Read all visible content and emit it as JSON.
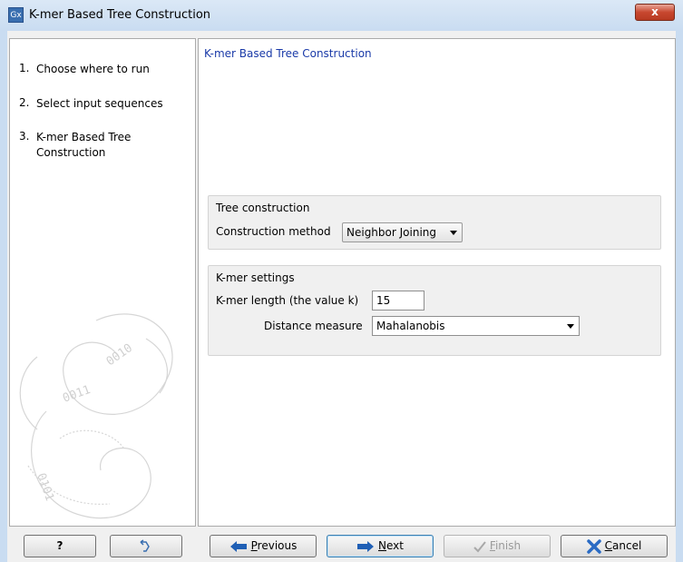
{
  "window": {
    "title": "K-mer Based Tree Construction",
    "app_icon": "Gx",
    "close_glyph": "x"
  },
  "steps": [
    {
      "num": "1.",
      "label": "Choose where to run"
    },
    {
      "num": "2.",
      "label": "Select input sequences"
    },
    {
      "num": "3.",
      "label": "K-mer Based Tree Construction"
    }
  ],
  "content": {
    "title": "K-mer Based Tree Construction",
    "tree_group": {
      "title": "Tree construction",
      "method_label": "Construction method",
      "method_value": "Neighbor Joining"
    },
    "kmer_group": {
      "title": "K-mer settings",
      "length_label": "K-mer length (the value k)",
      "length_value": "15",
      "distance_label": "Distance measure",
      "distance_value": "Mahalanobis"
    }
  },
  "buttons": {
    "help": "?",
    "previous_u": "P",
    "previous_rest": "revious",
    "next_u": "N",
    "next_rest": "ext",
    "finish_u": "F",
    "finish_rest": "inish",
    "cancel_u": "C",
    "cancel_rest": "ancel"
  },
  "icons": {
    "help": "question-mark",
    "reset": "undo-arrow-icon",
    "previous": "left-arrow-icon",
    "next": "right-arrow-icon",
    "finish": "check-icon",
    "cancel": "x-icon"
  },
  "colors": {
    "link_blue": "#1a3aa8",
    "arrow_blue": "#1f5fb5",
    "cancel_x": "#2a6bc4"
  }
}
